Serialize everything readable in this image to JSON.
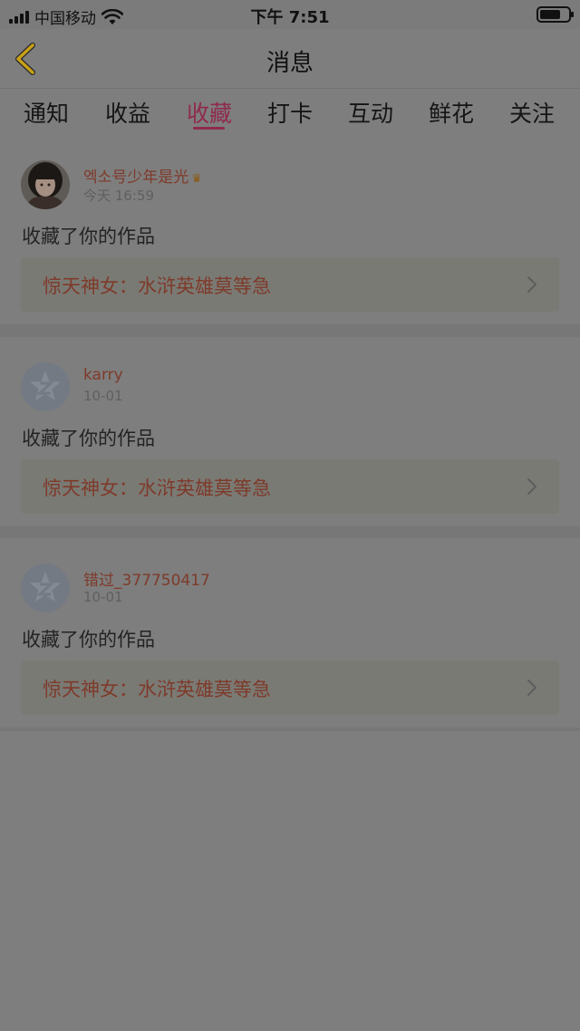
{
  "status_bar": {
    "carrier": "中国移动",
    "time": "下午 7:51"
  },
  "nav": {
    "title": "消息"
  },
  "tabs": [
    {
      "label": "通知",
      "active": false
    },
    {
      "label": "收益",
      "active": false
    },
    {
      "label": "收藏",
      "active": true
    },
    {
      "label": "打卡",
      "active": false
    },
    {
      "label": "互动",
      "active": false
    },
    {
      "label": "鲜花",
      "active": false
    },
    {
      "label": "关注",
      "active": false
    }
  ],
  "messages": [
    {
      "username": "엑소号少年是光",
      "vip": "♛",
      "time": "今天 16:59",
      "action": "收藏了你的作品",
      "work_title": "惊天神女：水浒英雄莫等急"
    },
    {
      "username": "karry",
      "time": "10-01",
      "action": "收藏了你的作品",
      "work_title": "惊天神女：水浒英雄莫等急"
    },
    {
      "username": "错过_377750417",
      "time": "10-01",
      "action": "收藏了你的作品",
      "work_title": "惊天神女：水浒英雄莫等急"
    }
  ],
  "colors": {
    "accent": "#8f2a4e",
    "username": "#7e3a2a",
    "back_arrow": "#c8a018"
  }
}
